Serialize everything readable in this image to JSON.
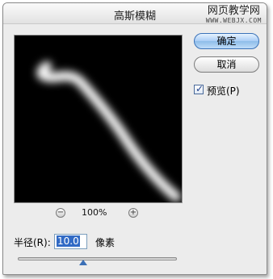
{
  "window": {
    "title": "高斯模糊"
  },
  "watermark": {
    "line1": "网页教学网",
    "line2": "WWW.WEBJX.COM"
  },
  "buttons": {
    "ok": "确定",
    "cancel": "取消"
  },
  "preview_option": {
    "label": "预览(P)",
    "checked": true
  },
  "zoom": {
    "level": "100%",
    "minus_icon": "zoom-out-icon",
    "plus_icon": "zoom-in-icon"
  },
  "radius": {
    "label": "半径(R):",
    "value": "10.0",
    "unit": "像素",
    "slider_fraction": 0.41
  },
  "colors": {
    "dialog_bg": "#ececec",
    "preview_bg": "#000000",
    "accent": "#316ac5"
  }
}
